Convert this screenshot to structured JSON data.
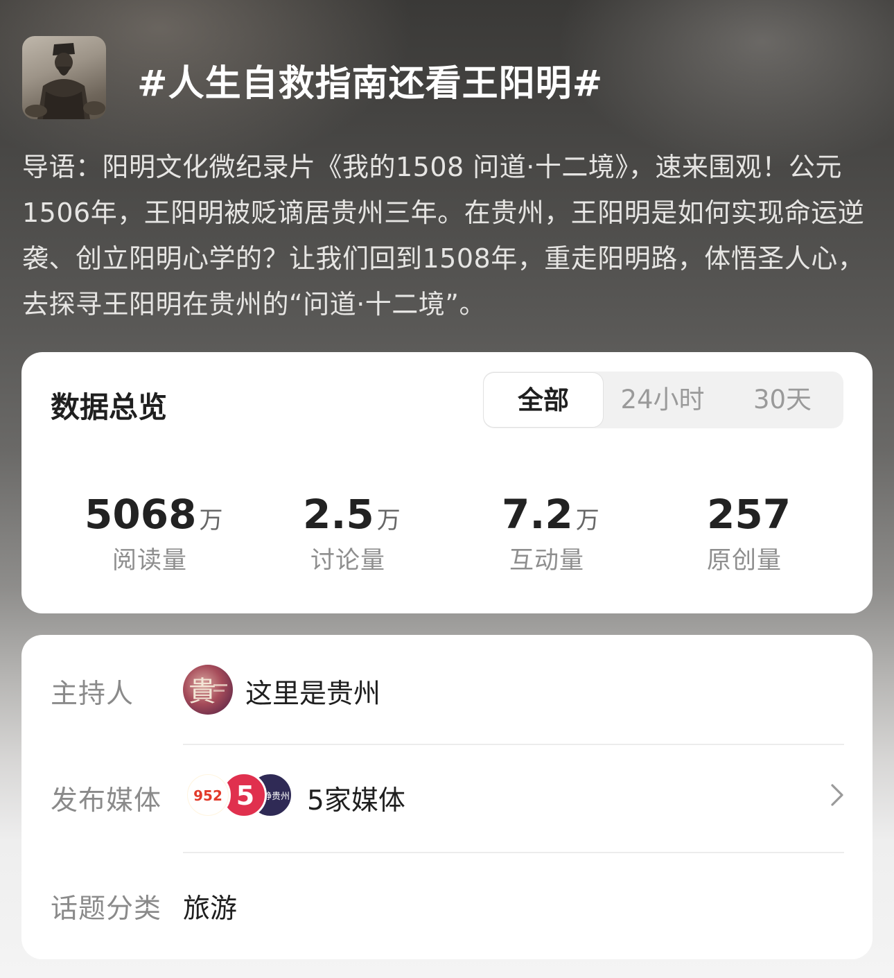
{
  "topic": {
    "title": "#人生自救指南还看王阳明#",
    "intro": "导语：阳明文化微纪录片《我的1508 问道·十二境》，速来围观！公元1506年，王阳明被贬谪居贵州三年。在贵州，王阳明是如何实现命运逆袭、创立阳明心学的？让我们回到1508年，重走阳明路，体悟圣人心，去探寻王阳明在贵州的“问道·十二境”。"
  },
  "overview": {
    "title": "数据总览",
    "tabs": [
      {
        "label": "全部",
        "active": true
      },
      {
        "label": "24小时",
        "active": false
      },
      {
        "label": "30天",
        "active": false
      }
    ],
    "stats": [
      {
        "value": "5068",
        "unit": "万",
        "label": "阅读量"
      },
      {
        "value": "2.5",
        "unit": "万",
        "label": "讨论量"
      },
      {
        "value": "7.2",
        "unit": "万",
        "label": "互动量"
      },
      {
        "value": "257",
        "unit": "",
        "label": "原创量"
      }
    ]
  },
  "info": {
    "host_label": "主持人",
    "host_name": "这里是贵州",
    "host_avatar_text": "貴",
    "media_label": "发布媒体",
    "media_logos": [
      {
        "text": "952",
        "color": "#f4a11a"
      },
      {
        "text": "5",
        "color": "#e0304e"
      },
      {
        "text": "动静贵州",
        "color": "#2f2a55"
      }
    ],
    "media_count": "5家媒体",
    "category_label": "话题分类",
    "category": "旅游"
  },
  "icons": {
    "chevron": "chevron-right-icon"
  }
}
